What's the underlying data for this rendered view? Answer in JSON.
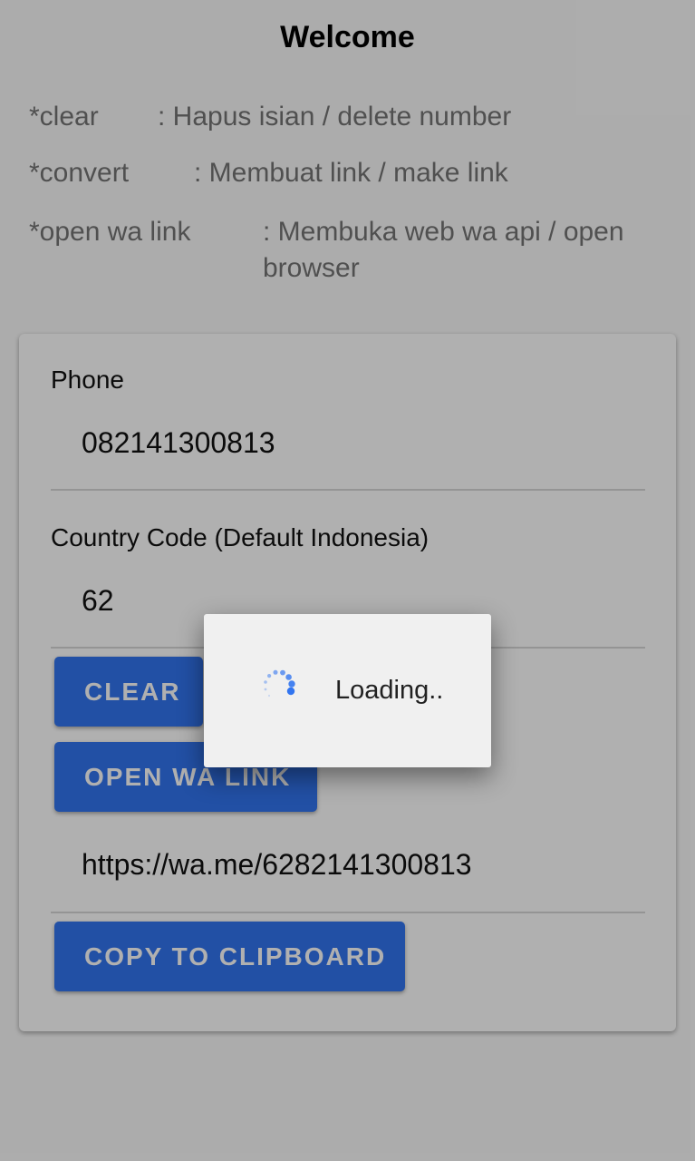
{
  "header": {
    "title": "Welcome"
  },
  "help": [
    {
      "key": "*clear",
      "desc": ": Hapus isian / delete number"
    },
    {
      "key": "*convert",
      "desc": ": Membuat link / make link"
    },
    {
      "key": "*open wa link",
      "desc": ": Membuka web wa api / open browser"
    }
  ],
  "form": {
    "phone_label": "Phone",
    "phone_value": "082141300813",
    "country_label": "Country Code (Default Indonesia)",
    "country_value": "62",
    "clear_label": "CLEAR",
    "open_label": "OPEN WA LINK",
    "link_value": "https://wa.me/6282141300813",
    "copy_label": "COPY TO CLIPBOARD"
  },
  "dialog": {
    "loading_text": "Loading..",
    "spinner_icon": "spinner-icon"
  },
  "colors": {
    "accent": "#3275f0",
    "button_text": "#ffffff",
    "muted_text": "#747474"
  }
}
